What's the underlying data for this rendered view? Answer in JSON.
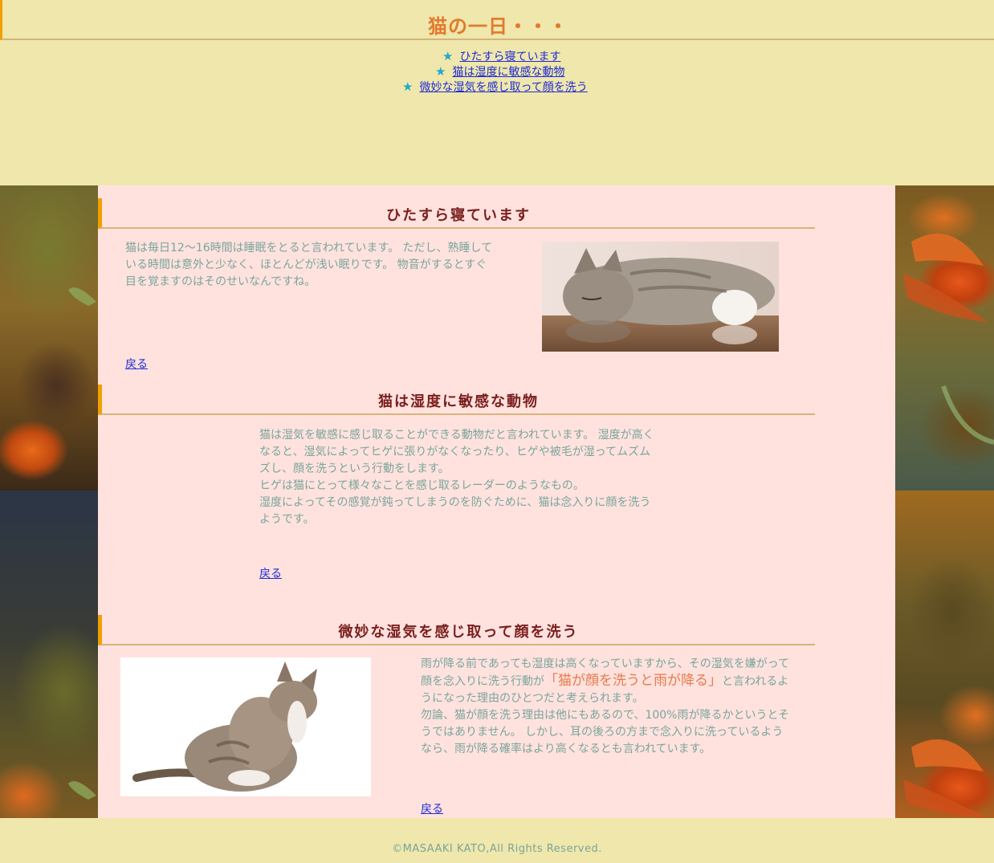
{
  "header": {
    "title": "猫の一日・・・"
  },
  "toc": [
    {
      "label": "ひたすら寝ています"
    },
    {
      "label": "猫は湿度に敏感な動物"
    },
    {
      "label": "微妙な湿気を感じ取って顔を洗う"
    }
  ],
  "sections": [
    {
      "heading": "ひたすら寝ています",
      "paragraphs": [
        "猫は毎日12～16時間は睡眠をとると言われています。 ただし、熟睡している時間は意外と少なく、ほとんどが浅い眠りです。 物音がするとすぐ目を覚ますのはそのせいなんですね。"
      ],
      "back_label": "戻る"
    },
    {
      "heading": "猫は湿度に敏感な動物",
      "paragraphs": [
        "猫は湿気を敏感に感じ取ることができる動物だと言われています。 湿度が高くなると、湿気によってヒゲに張りがなくなったり、ヒゲや被毛が湿ってムズムズし、顔を洗うという行動をします。",
        "ヒゲは猫にとって様々なことを感じ取るレーダーのようなもの。",
        "湿度によってその感覚が鈍ってしまうのを防ぐために、猫は念入りに顔を洗うようです。"
      ],
      "back_label": "戻る"
    },
    {
      "heading": "微妙な湿気を感じ取って顔を洗う",
      "para1_before": "雨が降る前であっても湿度は高くなっていますから、その湿気を嫌がって顔を念入りに洗う行動が",
      "para1_highlight": "「猫が顔を洗うと雨が降る」",
      "para1_after": "と言われるようになった理由のひとつだと考えられます。",
      "para2": "勿論、猫が顔を洗う理由は他にもあるので、100%雨が降るかというとそうではありません。 しかし、耳の後ろの方まで念入りに洗っているようなら、雨が降る確率はより高くなるとも言われています。",
      "back_label": "戻る"
    }
  ],
  "footer": {
    "copyright": "©MASAAKI KATO,All Rights Reserved."
  },
  "colors": {
    "page_bg": "#efe7ab",
    "content_bg": "#ffe2de",
    "heading": "#7a1e1e",
    "body_text": "#7aa59c",
    "accent_orange": "#f0a000",
    "link": "#1f2bd6",
    "star": "#22a8c9"
  }
}
